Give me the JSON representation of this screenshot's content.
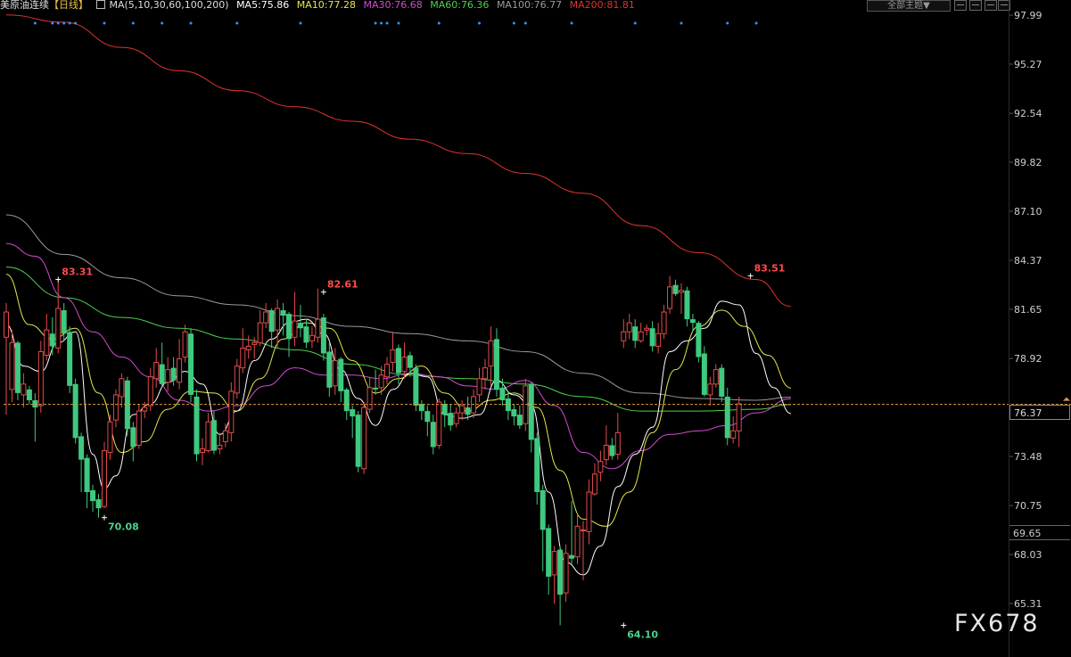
{
  "header": {
    "instrument": "美原油连续",
    "period": "【日线】",
    "ma_params": "MA(5,10,30,60,100,200)",
    "ma5": "MA5:75.86",
    "ma10": "MA10:77.28",
    "ma30": "MA30:76.68",
    "ma60": "MA60:76.36",
    "ma100": "MA100:76.77",
    "ma200": "MA200:81.81",
    "theme_button": "全部主题▼"
  },
  "colors": {
    "up": "#e24b4b",
    "down": "#3fc97f",
    "ma5": "#ffffff",
    "ma10": "#e6e64a",
    "ma30": "#d24bd2",
    "ma60": "#4bd24b",
    "ma100": "#9a9a9a",
    "ma200": "#e0332e",
    "current": "#e39a3a"
  },
  "current_price": "76.37",
  "low_marker": "69.65",
  "watermark": "FX678",
  "chart_data": {
    "type": "candlestick",
    "ylim": [
      63.5,
      98.5
    ],
    "y_ticks": [
      "97.99",
      "95.27",
      "92.54",
      "89.82",
      "87.10",
      "84.37",
      "81.65",
      "78.92",
      "73.48",
      "70.75",
      "68.03",
      "65.31"
    ],
    "current_price": 76.37,
    "annotations": [
      {
        "label": "83.31",
        "x": 9,
        "y": 83.31,
        "kind": "high"
      },
      {
        "label": "70.08",
        "x": 17,
        "y": 70.08,
        "kind": "low"
      },
      {
        "label": "82.61",
        "x": 55,
        "y": 82.61,
        "kind": "high"
      },
      {
        "label": "64.10",
        "x": 107,
        "y": 64.1,
        "kind": "low"
      },
      {
        "label": "83.51",
        "x": 129,
        "y": 83.51,
        "kind": "high"
      }
    ],
    "candles": [
      [
        80.1,
        81.5,
        82.0,
        75.8
      ],
      [
        77.2,
        79.8,
        80.5,
        76.5
      ],
      [
        79.8,
        77.0,
        79.9,
        76.6
      ],
      [
        76.9,
        77.5,
        78.1,
        76.2
      ],
      [
        77.2,
        76.6,
        77.4,
        76.4
      ],
      [
        76.6,
        76.2,
        77.0,
        74.3
      ],
      [
        76.3,
        79.3,
        79.9,
        75.9
      ],
      [
        79.1,
        80.5,
        81.4,
        78.8
      ],
      [
        80.3,
        79.6,
        81.2,
        79.1
      ],
      [
        79.5,
        81.7,
        83.31,
        79.2
      ],
      [
        81.6,
        80.3,
        82.0,
        79.9
      ],
      [
        80.4,
        77.4,
        80.7,
        77.0
      ],
      [
        77.5,
        74.5,
        77.8,
        74.2
      ],
      [
        74.6,
        73.3,
        74.8,
        71.5
      ],
      [
        73.4,
        71.5,
        73.6,
        70.6
      ],
      [
        71.6,
        71.0,
        71.9,
        70.4
      ],
      [
        71.1,
        70.6,
        71.4,
        70.08
      ],
      [
        70.7,
        73.8,
        74.3,
        70.6
      ],
      [
        73.7,
        75.4,
        75.8,
        73.3
      ],
      [
        75.5,
        76.9,
        77.2,
        75.1
      ],
      [
        76.8,
        77.8,
        78.1,
        76.2
      ],
      [
        77.7,
        75.0,
        77.9,
        74.6
      ],
      [
        75.1,
        74.0,
        75.4,
        73.2
      ],
      [
        74.1,
        76.0,
        76.4,
        73.9
      ],
      [
        76.0,
        76.2,
        76.5,
        75.6
      ],
      [
        76.3,
        77.9,
        78.4,
        76.0
      ],
      [
        77.8,
        78.7,
        79.5,
        77.3
      ],
      [
        78.6,
        77.5,
        79.8,
        77.3
      ],
      [
        77.6,
        78.3,
        79.0,
        77.1
      ],
      [
        78.4,
        77.7,
        79.0,
        77.4
      ],
      [
        77.6,
        78.9,
        80.0,
        77.2
      ],
      [
        79.0,
        80.4,
        80.8,
        78.7
      ],
      [
        80.3,
        76.9,
        80.6,
        76.5
      ],
      [
        76.8,
        73.6,
        77.2,
        73.2
      ],
      [
        73.7,
        73.9,
        74.5,
        73.0
      ],
      [
        73.8,
        75.4,
        75.9,
        73.7
      ],
      [
        75.5,
        73.8,
        76.0,
        73.6
      ],
      [
        73.9,
        74.1,
        74.8,
        73.6
      ],
      [
        74.3,
        74.9,
        75.3,
        74.0
      ],
      [
        74.8,
        77.1,
        77.6,
        74.3
      ],
      [
        77.0,
        78.5,
        78.9,
        76.7
      ],
      [
        78.4,
        79.5,
        80.6,
        78.1
      ],
      [
        79.4,
        79.6,
        80.2,
        78.9
      ],
      [
        79.7,
        79.8,
        80.1,
        78.9
      ],
      [
        79.8,
        80.9,
        81.6,
        79.6
      ],
      [
        80.9,
        81.5,
        82.0,
        80.6
      ],
      [
        81.6,
        80.4,
        81.7,
        79.5
      ],
      [
        80.5,
        81.7,
        82.2,
        79.5
      ],
      [
        81.6,
        81.3,
        82.0,
        80.2
      ],
      [
        81.4,
        80.0,
        81.5,
        79.0
      ],
      [
        80.1,
        81.0,
        82.61,
        79.6
      ],
      [
        80.9,
        80.6,
        81.9,
        80.1
      ],
      [
        80.7,
        79.8,
        81.1,
        79.5
      ],
      [
        79.9,
        80.2,
        80.7,
        79.5
      ],
      [
        80.1,
        81.1,
        82.8,
        79.8
      ],
      [
        81.2,
        79.2,
        81.4,
        78.8
      ],
      [
        79.3,
        77.3,
        79.8,
        76.8
      ],
      [
        77.4,
        78.8,
        79.5,
        76.9
      ],
      [
        78.9,
        77.1,
        79.0,
        76.5
      ],
      [
        77.2,
        76.0,
        77.3,
        75.5
      ],
      [
        76.1,
        75.7,
        76.3,
        74.5
      ],
      [
        75.8,
        72.9,
        76.0,
        72.6
      ],
      [
        72.8,
        76.2,
        76.5,
        72.5
      ],
      [
        76.1,
        77.3,
        77.9,
        75.9
      ],
      [
        77.3,
        77.2,
        78.3,
        76.9
      ],
      [
        77.3,
        78.0,
        78.5,
        76.9
      ],
      [
        77.9,
        78.6,
        79.0,
        77.5
      ],
      [
        78.7,
        79.4,
        80.4,
        78.2
      ],
      [
        79.5,
        78.1,
        79.7,
        77.5
      ],
      [
        78.2,
        79.0,
        79.8,
        77.8
      ],
      [
        79.1,
        78.4,
        79.3,
        77.9
      ],
      [
        78.4,
        76.3,
        78.6,
        76.0
      ],
      [
        76.4,
        76.0,
        76.6,
        75.5
      ],
      [
        76.0,
        75.4,
        76.3,
        74.6
      ],
      [
        75.4,
        74.0,
        75.8,
        73.6
      ],
      [
        74.1,
        76.5,
        76.7,
        73.9
      ],
      [
        76.4,
        75.8,
        76.6,
        75.1
      ],
      [
        75.9,
        75.2,
        76.4,
        74.9
      ],
      [
        75.3,
        75.9,
        76.2,
        75.1
      ],
      [
        75.9,
        76.3,
        76.6,
        75.5
      ],
      [
        76.2,
        75.8,
        76.8,
        75.5
      ],
      [
        75.9,
        76.8,
        77.2,
        75.6
      ],
      [
        76.9,
        77.8,
        78.4,
        76.5
      ],
      [
        77.8,
        78.4,
        78.9,
        77.2
      ],
      [
        78.5,
        79.9,
        80.7,
        77.4
      ],
      [
        80.0,
        77.2,
        80.6,
        76.8
      ],
      [
        77.3,
        76.6,
        77.8,
        76.3
      ],
      [
        76.7,
        76.0,
        77.1,
        75.5
      ],
      [
        76.1,
        75.7,
        76.4,
        75.2
      ],
      [
        75.8,
        75.2,
        76.3,
        75.0
      ],
      [
        75.3,
        77.4,
        77.8,
        74.9
      ],
      [
        77.5,
        74.4,
        77.6,
        73.7
      ],
      [
        74.5,
        71.5,
        74.8,
        70.8
      ],
      [
        71.6,
        69.4,
        71.9,
        67.1
      ],
      [
        69.5,
        66.8,
        69.7,
        65.8
      ],
      [
        66.9,
        68.2,
        68.5,
        65.3
      ],
      [
        68.3,
        65.8,
        68.5,
        64.1
      ],
      [
        65.9,
        68.1,
        68.6,
        65.4
      ],
      [
        68.0,
        67.8,
        71.0,
        67.5
      ],
      [
        67.9,
        69.6,
        70.3,
        67.5
      ],
      [
        69.4,
        69.4,
        69.9,
        66.6
      ],
      [
        69.3,
        71.5,
        72.2,
        68.6
      ],
      [
        71.4,
        72.5,
        73.1,
        71.3
      ],
      [
        72.6,
        73.2,
        73.8,
        72.1
      ],
      [
        73.3,
        74.1,
        75.2,
        73.0
      ],
      [
        74.1,
        73.5,
        74.5,
        73.3
      ],
      [
        73.6,
        74.8,
        75.9,
        73.3
      ],
      [
        79.9,
        80.4,
        81.1,
        79.5
      ],
      [
        80.4,
        80.9,
        81.4,
        80.0
      ],
      [
        80.7,
        79.9,
        81.1,
        79.5
      ],
      [
        79.9,
        80.4,
        80.9,
        79.8
      ],
      [
        80.5,
        80.6,
        80.8,
        80.2
      ],
      [
        80.6,
        79.6,
        81.0,
        79.3
      ],
      [
        79.6,
        80.3,
        80.9,
        79.2
      ],
      [
        80.3,
        81.5,
        81.9,
        80.0
      ],
      [
        81.7,
        82.9,
        83.51,
        81.4
      ],
      [
        83.0,
        82.5,
        83.3,
        82.4
      ],
      [
        82.6,
        82.7,
        83.1,
        81.4
      ],
      [
        82.7,
        81.1,
        82.9,
        80.7
      ],
      [
        81.1,
        80.9,
        81.4,
        80.4
      ],
      [
        80.9,
        79.0,
        81.0,
        78.7
      ],
      [
        79.2,
        76.9,
        79.6,
        76.8
      ],
      [
        76.9,
        77.5,
        77.9,
        76.3
      ],
      [
        77.5,
        78.3,
        78.6,
        77.3
      ],
      [
        78.4,
        76.8,
        78.6,
        76.5
      ],
      [
        76.8,
        74.5,
        77.3,
        74.1
      ],
      [
        74.5,
        74.9,
        75.7,
        74.2
      ],
      [
        74.9,
        76.4,
        76.8,
        74.0
      ]
    ],
    "ma_end_values": {
      "ma5": 75.86,
      "ma10": 77.28,
      "ma30": 76.68,
      "ma60": 76.36,
      "ma100": 76.77,
      "ma200": 81.81
    },
    "ma_series": {
      "ma200": {
        "x": [
          0,
          10,
          20,
          30,
          40,
          50,
          60,
          70,
          80,
          90,
          100,
          110,
          120,
          130,
          136
        ],
        "y": [
          98.0,
          97.6,
          96.2,
          94.9,
          93.8,
          92.9,
          92.1,
          91.1,
          90.3,
          89.2,
          88.1,
          86.3,
          84.8,
          83.3,
          81.81
        ]
      },
      "ma100": {
        "x": [
          0,
          10,
          20,
          30,
          40,
          50,
          60,
          70,
          80,
          90,
          100,
          110,
          120,
          130,
          136
        ],
        "y": [
          86.9,
          84.7,
          83.4,
          82.4,
          81.9,
          81.3,
          80.7,
          80.3,
          79.9,
          79.3,
          78.1,
          77.0,
          76.7,
          76.6,
          76.77
        ]
      },
      "ma60": {
        "x": [
          0,
          10,
          20,
          30,
          40,
          50,
          60,
          70,
          80,
          90,
          100,
          110,
          120,
          130,
          136
        ],
        "y": [
          84.0,
          82.3,
          81.2,
          80.6,
          80.0,
          79.4,
          78.6,
          78.0,
          77.8,
          77.5,
          76.8,
          76.0,
          76.0,
          76.1,
          76.36
        ]
      },
      "ma30": {
        "x": [
          0,
          5,
          10,
          15,
          20,
          25,
          30,
          35,
          40,
          45,
          50,
          55,
          60,
          65,
          70,
          75,
          80,
          85,
          90,
          95,
          100,
          105,
          110,
          115,
          120,
          125,
          130,
          136
        ],
        "y": [
          85.3,
          84.6,
          82.3,
          80.4,
          79.0,
          77.9,
          76.6,
          76.0,
          76.3,
          77.4,
          78.4,
          78.0,
          78.0,
          77.8,
          78.1,
          77.9,
          77.4,
          77.2,
          77.7,
          76.3,
          73.7,
          72.8,
          73.8,
          74.7,
          74.9,
          75.2,
          75.9,
          76.68
        ]
      },
      "ma10": {
        "x": [
          0,
          4,
          8,
          12,
          16,
          20,
          24,
          28,
          32,
          36,
          40,
          44,
          48,
          52,
          56,
          60,
          64,
          68,
          72,
          76,
          80,
          84,
          88,
          92,
          96,
          100,
          104,
          108,
          112,
          116,
          120,
          124,
          128,
          132,
          136
        ],
        "y": [
          83.6,
          80.8,
          80.0,
          80.6,
          77.0,
          73.7,
          74.3,
          76.1,
          77.1,
          77.0,
          76.0,
          77.8,
          80.0,
          80.9,
          80.6,
          78.8,
          77.0,
          77.8,
          78.5,
          77.0,
          76.0,
          76.6,
          77.0,
          76.2,
          72.7,
          70.0,
          69.6,
          71.5,
          74.8,
          78.3,
          80.7,
          81.6,
          80.7,
          79.1,
          77.28
        ]
      },
      "ma5": {
        "x": [
          0,
          3,
          6,
          9,
          12,
          15,
          17,
          19,
          22,
          25,
          28,
          31,
          34,
          37,
          40,
          43,
          46,
          49,
          52,
          55,
          58,
          61,
          64,
          67,
          70,
          73,
          76,
          79,
          82,
          85,
          88,
          91,
          94,
          97,
          100,
          103,
          106,
          109,
          112,
          115,
          118,
          121,
          124,
          127,
          130,
          133,
          136
        ],
        "y": [
          80.8,
          78.5,
          78.2,
          79.8,
          80.4,
          73.6,
          71.7,
          72.4,
          75.8,
          76.4,
          77.6,
          78.2,
          77.5,
          74.7,
          76.0,
          78.8,
          80.0,
          80.9,
          81.1,
          80.3,
          78.3,
          76.7,
          75.2,
          77.2,
          78.1,
          77.9,
          75.8,
          75.6,
          75.8,
          77.7,
          76.9,
          76.3,
          71.5,
          67.6,
          66.9,
          68.5,
          71.8,
          73.6,
          75.1,
          79.3,
          79.9,
          80.6,
          82.1,
          81.9,
          79.2,
          77.3,
          75.86
        ]
      }
    }
  }
}
